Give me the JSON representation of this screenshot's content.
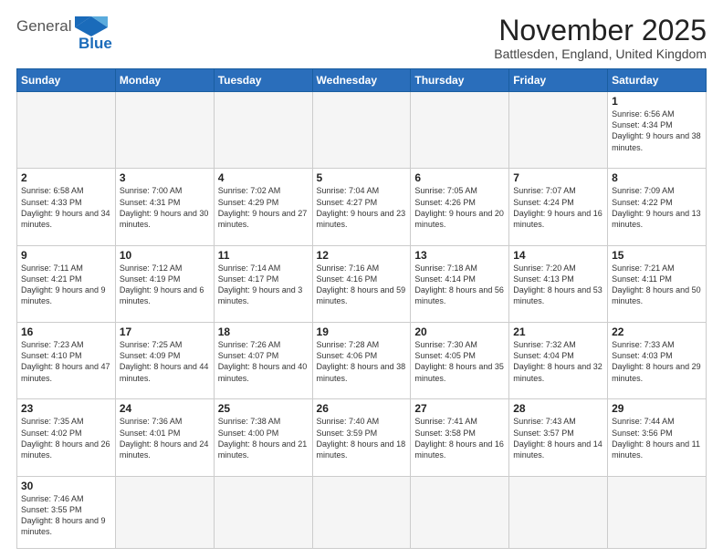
{
  "logo": {
    "text_general": "General",
    "text_blue": "Blue"
  },
  "header": {
    "month": "November 2025",
    "location": "Battlesden, England, United Kingdom"
  },
  "days_of_week": [
    "Sunday",
    "Monday",
    "Tuesday",
    "Wednesday",
    "Thursday",
    "Friday",
    "Saturday"
  ],
  "weeks": [
    [
      {
        "day": "",
        "info": ""
      },
      {
        "day": "",
        "info": ""
      },
      {
        "day": "",
        "info": ""
      },
      {
        "day": "",
        "info": ""
      },
      {
        "day": "",
        "info": ""
      },
      {
        "day": "",
        "info": ""
      },
      {
        "day": "1",
        "info": "Sunrise: 6:56 AM\nSunset: 4:34 PM\nDaylight: 9 hours and 38 minutes."
      }
    ],
    [
      {
        "day": "2",
        "info": "Sunrise: 6:58 AM\nSunset: 4:33 PM\nDaylight: 9 hours and 34 minutes."
      },
      {
        "day": "3",
        "info": "Sunrise: 7:00 AM\nSunset: 4:31 PM\nDaylight: 9 hours and 30 minutes."
      },
      {
        "day": "4",
        "info": "Sunrise: 7:02 AM\nSunset: 4:29 PM\nDaylight: 9 hours and 27 minutes."
      },
      {
        "day": "5",
        "info": "Sunrise: 7:04 AM\nSunset: 4:27 PM\nDaylight: 9 hours and 23 minutes."
      },
      {
        "day": "6",
        "info": "Sunrise: 7:05 AM\nSunset: 4:26 PM\nDaylight: 9 hours and 20 minutes."
      },
      {
        "day": "7",
        "info": "Sunrise: 7:07 AM\nSunset: 4:24 PM\nDaylight: 9 hours and 16 minutes."
      },
      {
        "day": "8",
        "info": "Sunrise: 7:09 AM\nSunset: 4:22 PM\nDaylight: 9 hours and 13 minutes."
      }
    ],
    [
      {
        "day": "9",
        "info": "Sunrise: 7:11 AM\nSunset: 4:21 PM\nDaylight: 9 hours and 9 minutes."
      },
      {
        "day": "10",
        "info": "Sunrise: 7:12 AM\nSunset: 4:19 PM\nDaylight: 9 hours and 6 minutes."
      },
      {
        "day": "11",
        "info": "Sunrise: 7:14 AM\nSunset: 4:17 PM\nDaylight: 9 hours and 3 minutes."
      },
      {
        "day": "12",
        "info": "Sunrise: 7:16 AM\nSunset: 4:16 PM\nDaylight: 8 hours and 59 minutes."
      },
      {
        "day": "13",
        "info": "Sunrise: 7:18 AM\nSunset: 4:14 PM\nDaylight: 8 hours and 56 minutes."
      },
      {
        "day": "14",
        "info": "Sunrise: 7:20 AM\nSunset: 4:13 PM\nDaylight: 8 hours and 53 minutes."
      },
      {
        "day": "15",
        "info": "Sunrise: 7:21 AM\nSunset: 4:11 PM\nDaylight: 8 hours and 50 minutes."
      }
    ],
    [
      {
        "day": "16",
        "info": "Sunrise: 7:23 AM\nSunset: 4:10 PM\nDaylight: 8 hours and 47 minutes."
      },
      {
        "day": "17",
        "info": "Sunrise: 7:25 AM\nSunset: 4:09 PM\nDaylight: 8 hours and 44 minutes."
      },
      {
        "day": "18",
        "info": "Sunrise: 7:26 AM\nSunset: 4:07 PM\nDaylight: 8 hours and 40 minutes."
      },
      {
        "day": "19",
        "info": "Sunrise: 7:28 AM\nSunset: 4:06 PM\nDaylight: 8 hours and 38 minutes."
      },
      {
        "day": "20",
        "info": "Sunrise: 7:30 AM\nSunset: 4:05 PM\nDaylight: 8 hours and 35 minutes."
      },
      {
        "day": "21",
        "info": "Sunrise: 7:32 AM\nSunset: 4:04 PM\nDaylight: 8 hours and 32 minutes."
      },
      {
        "day": "22",
        "info": "Sunrise: 7:33 AM\nSunset: 4:03 PM\nDaylight: 8 hours and 29 minutes."
      }
    ],
    [
      {
        "day": "23",
        "info": "Sunrise: 7:35 AM\nSunset: 4:02 PM\nDaylight: 8 hours and 26 minutes."
      },
      {
        "day": "24",
        "info": "Sunrise: 7:36 AM\nSunset: 4:01 PM\nDaylight: 8 hours and 24 minutes."
      },
      {
        "day": "25",
        "info": "Sunrise: 7:38 AM\nSunset: 4:00 PM\nDaylight: 8 hours and 21 minutes."
      },
      {
        "day": "26",
        "info": "Sunrise: 7:40 AM\nSunset: 3:59 PM\nDaylight: 8 hours and 18 minutes."
      },
      {
        "day": "27",
        "info": "Sunrise: 7:41 AM\nSunset: 3:58 PM\nDaylight: 8 hours and 16 minutes."
      },
      {
        "day": "28",
        "info": "Sunrise: 7:43 AM\nSunset: 3:57 PM\nDaylight: 8 hours and 14 minutes."
      },
      {
        "day": "29",
        "info": "Sunrise: 7:44 AM\nSunset: 3:56 PM\nDaylight: 8 hours and 11 minutes."
      }
    ],
    [
      {
        "day": "30",
        "info": "Sunrise: 7:46 AM\nSunset: 3:55 PM\nDaylight: 8 hours and 9 minutes."
      },
      {
        "day": "",
        "info": ""
      },
      {
        "day": "",
        "info": ""
      },
      {
        "day": "",
        "info": ""
      },
      {
        "day": "",
        "info": ""
      },
      {
        "day": "",
        "info": ""
      },
      {
        "day": "",
        "info": ""
      }
    ]
  ]
}
